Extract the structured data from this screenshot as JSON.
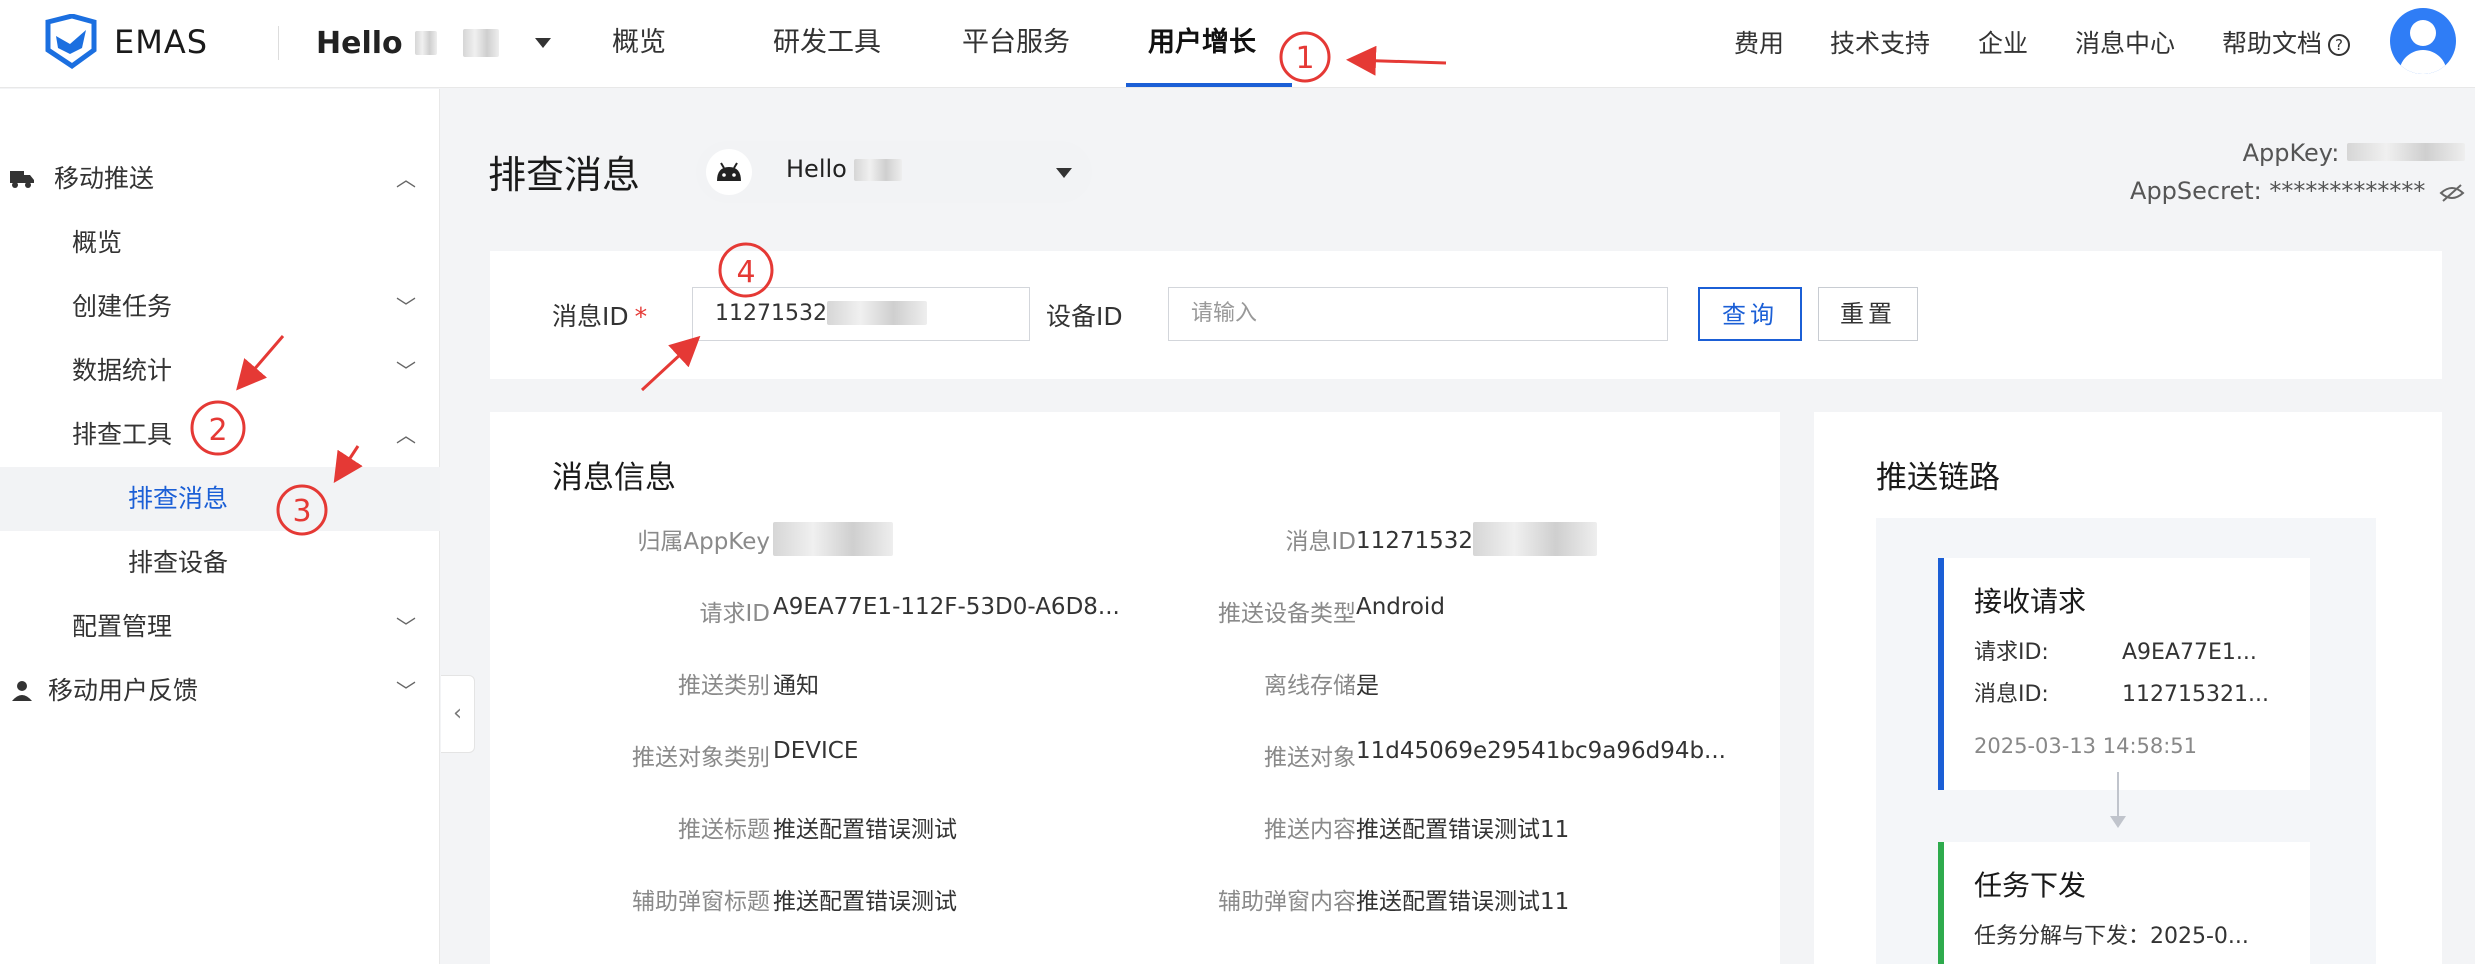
{
  "brand": {
    "name": "EMAS"
  },
  "app_switcher": {
    "label": "Hello"
  },
  "top_nav": [
    {
      "label": "概览"
    },
    {
      "label": "研发工具"
    },
    {
      "label": "平台服务"
    },
    {
      "label": "用户增长"
    }
  ],
  "right_nav": [
    "费用",
    "技术支持",
    "企业",
    "消息中心",
    "帮助文档"
  ],
  "help_icon": "question-circle-icon",
  "sidebar": {
    "sections": [
      {
        "label": "移动推送",
        "icon": "push-truck-icon"
      },
      {
        "label": "移动用户反馈",
        "icon": "feedback-person-icon"
      }
    ],
    "items": [
      {
        "label": "概览"
      },
      {
        "label": "创建任务"
      },
      {
        "label": "数据统计"
      },
      {
        "label": "排查工具"
      },
      {
        "label": "排查消息"
      },
      {
        "label": "排查设备"
      },
      {
        "label": "配置管理"
      }
    ]
  },
  "page": {
    "title": "排查消息",
    "app_select": "Hello",
    "appkey_label": "AppKey:",
    "appsecret_label": "AppSecret:",
    "appsecret_value": "*************"
  },
  "search": {
    "message_id_label": "消息ID",
    "required_mark": "*",
    "message_id_value": "11271532",
    "device_id_label": "设备ID",
    "device_id_placeholder": "请输入",
    "query_button": "查询",
    "reset_button": "重置"
  },
  "message_info": {
    "title": "消息信息",
    "left": [
      {
        "label": "归属AppKey",
        "value": ""
      },
      {
        "label": "请求ID",
        "value": "A9EA77E1-112F-53D0-A6D8..."
      },
      {
        "label": "推送类别",
        "value": "通知"
      },
      {
        "label": "推送对象类别",
        "value": "DEVICE"
      },
      {
        "label": "推送标题",
        "value": "推送配置错误测试"
      },
      {
        "label": "辅助弹窗标题",
        "value": "推送配置错误测试"
      }
    ],
    "right": [
      {
        "label": "消息ID",
        "value": "11271532"
      },
      {
        "label": "推送设备类型",
        "value": "Android"
      },
      {
        "label": "离线存储",
        "value": "是"
      },
      {
        "label": "推送对象",
        "value": "11d45069e29541bc9a96d94b..."
      },
      {
        "label": "推送内容",
        "value": "推送配置错误测试11"
      },
      {
        "label": "辅助弹窗内容",
        "value": "推送配置错误测试11"
      }
    ]
  },
  "push_chain": {
    "title": "推送链路",
    "nodes": [
      {
        "title": "接收请求",
        "request_id_label": "请求ID:",
        "request_id_value": "A9EA77E1...",
        "message_id_label": "消息ID:",
        "message_id_value": "112715321...",
        "time": "2025-03-13 14:58:51"
      },
      {
        "title": "任务下发",
        "detail": "任务分解与下发：2025-0..."
      }
    ]
  },
  "annotations": [
    "1",
    "2",
    "3",
    "4"
  ],
  "colors": {
    "accent": "#1b5fd6",
    "annotation": "#e53935",
    "success": "#2eab4d"
  }
}
